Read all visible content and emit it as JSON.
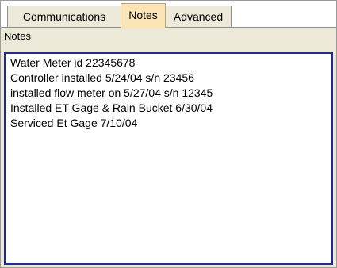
{
  "tabs": [
    {
      "label": "Communications",
      "active": false
    },
    {
      "label": "Notes",
      "active": true
    },
    {
      "label": "Advanced",
      "active": false
    }
  ],
  "notes": {
    "group_label": "Notes",
    "lines": [
      "Water Meter id 22345678",
      "Controller installed 5/24/04  s/n 23456",
      "installed flow meter on 5/27/04 s/n 12345",
      "Installed ET Gage & Rain Bucket 6/30/04",
      "Serviced Et Gage 7/10/04"
    ]
  },
  "colors": {
    "active_tab": "#fbe5b6",
    "inactive_tab": "#ece9d8",
    "panel": "#ece9d8",
    "textbox_border": "#1c2d8f"
  }
}
